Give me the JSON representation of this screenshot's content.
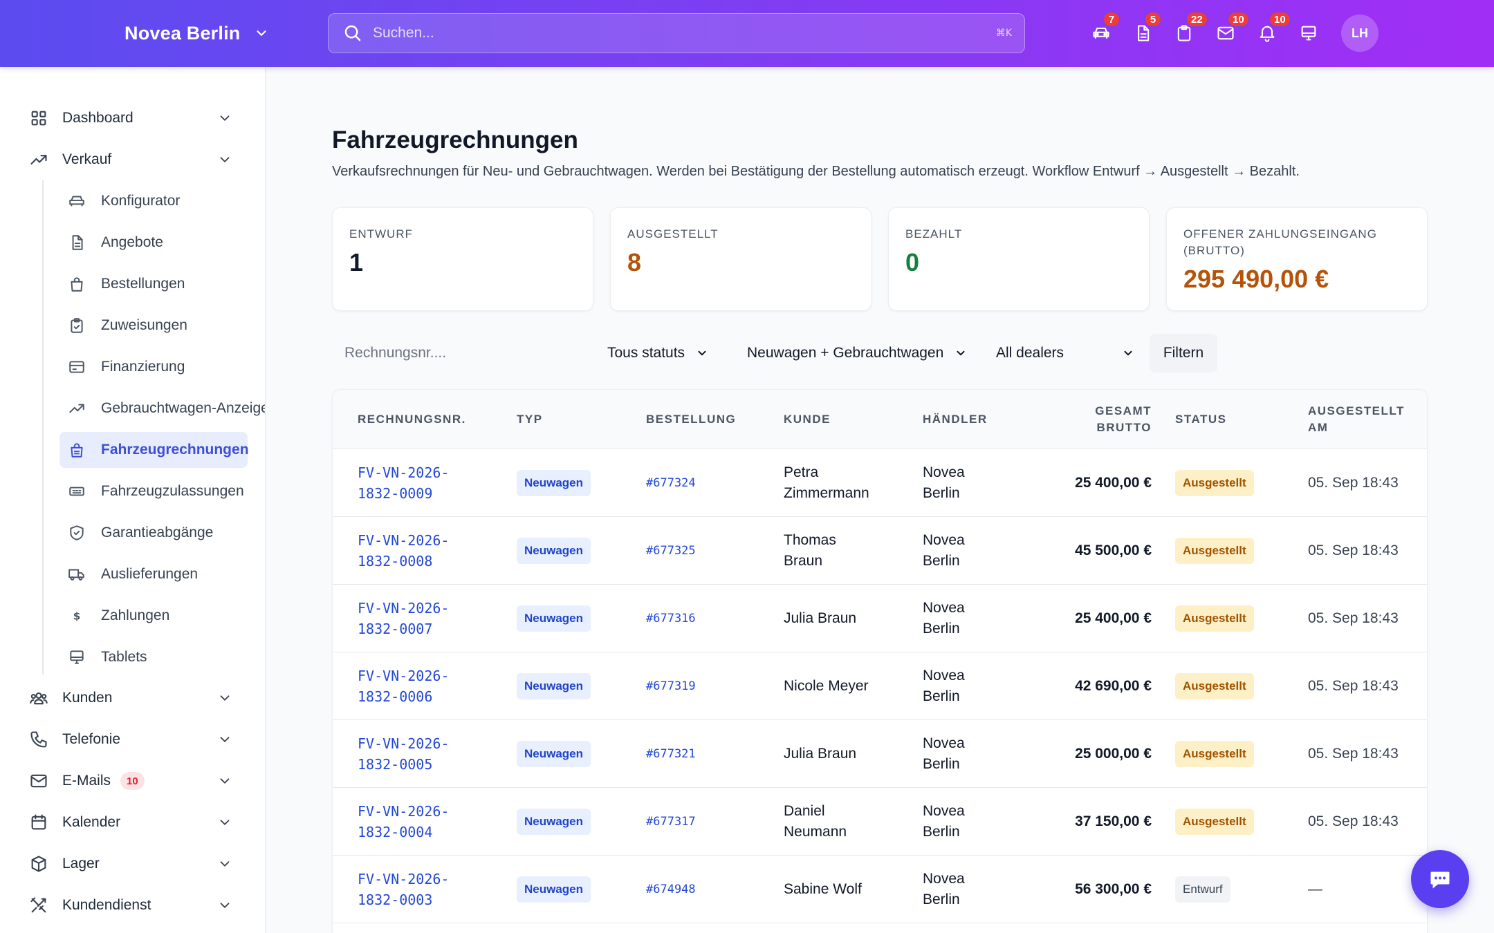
{
  "app": {
    "brand": "Novea Berlin",
    "search_placeholder": "Suchen...",
    "search_shortcut": "⌘K",
    "avatar_initials": "LH",
    "top_icons": [
      {
        "icon": "car-icon",
        "badge": "7"
      },
      {
        "icon": "document-icon",
        "badge": "5"
      },
      {
        "icon": "clipboard-icon",
        "badge": "22"
      },
      {
        "icon": "mail-icon",
        "badge": "10"
      },
      {
        "icon": "bell-icon",
        "badge": "10"
      },
      {
        "icon": "monitor-icon",
        "badge": ""
      }
    ],
    "colors": {
      "accent": "#3b4fd8",
      "amber": "#b45309",
      "green": "#15803d",
      "header_start": "#5b4cf0",
      "header_end": "#a12ef5"
    }
  },
  "sidebar": {
    "groups": {
      "dashboard": "Dashboard",
      "verkauf": "Verkauf",
      "kunden": "Kunden",
      "telefonie": "Telefonie",
      "emails": "E-Mails",
      "emails_badge": "10",
      "kalender": "Kalender",
      "lager": "Lager",
      "kundendienst": "Kundendienst"
    },
    "verkauf_items": [
      "Konfigurator",
      "Angebote",
      "Bestellungen",
      "Zuweisungen",
      "Finanzierung",
      "Gebrauchtwagen-Anzeigen",
      "Fahrzeugrechnungen",
      "Fahrzeugzulassungen",
      "Garantieabgänge",
      "Auslieferungen",
      "Zahlungen",
      "Tablets"
    ]
  },
  "page": {
    "title": "Fahrzeugrechnungen",
    "subtitle": "Verkaufsrechnungen für Neu- und Gebrauchtwagen. Werden bei Bestätigung der Bestellung automatisch erzeugt. Workflow Entwurf → Ausgestellt → Bezahlt."
  },
  "stats": [
    {
      "label": "Entwurf",
      "value": "1",
      "color": "#111827"
    },
    {
      "label": "Ausgestellt",
      "value": "8",
      "color": "#b45309"
    },
    {
      "label": "Bezahlt",
      "value": "0",
      "color": "#15803d"
    },
    {
      "label": "Offener Zahlungseingang (Brutto)",
      "value": "295 490,00 €",
      "color": "#b45309"
    }
  ],
  "filters": {
    "search_placeholder": "Rechnungsnr....",
    "status_selected": "Tous statuts",
    "type_selected": "Neuwagen + Gebrauchtwagen",
    "dealer_selected": "All dealers",
    "submit_label": "Filtern"
  },
  "table": {
    "columns": {
      "nr": "Rechnungsnr.",
      "typ": "Typ",
      "bestellung": "Bestellung",
      "kunde": "Kunde",
      "haendler": "Händler",
      "brutto": "Gesamt Brutto",
      "status": "Status",
      "ausgestellt": "Ausgestellt am"
    },
    "rows": [
      {
        "nr": "FV-VN-2026-1832-0009",
        "typ": "Neuwagen",
        "bestellung": "#677324",
        "kunde": "Petra Zimmermann",
        "haendler": "Novea Berlin",
        "brutto": "25 400,00 €",
        "status": "Ausgestellt",
        "datum": "05. Sep 18:43"
      },
      {
        "nr": "FV-VN-2026-1832-0008",
        "typ": "Neuwagen",
        "bestellung": "#677325",
        "kunde": "Thomas Braun",
        "haendler": "Novea Berlin",
        "brutto": "45 500,00 €",
        "status": "Ausgestellt",
        "datum": "05. Sep 18:43"
      },
      {
        "nr": "FV-VN-2026-1832-0007",
        "typ": "Neuwagen",
        "bestellung": "#677316",
        "kunde": "Julia Braun",
        "haendler": "Novea Berlin",
        "brutto": "25 400,00 €",
        "status": "Ausgestellt",
        "datum": "05. Sep 18:43"
      },
      {
        "nr": "FV-VN-2026-1832-0006",
        "typ": "Neuwagen",
        "bestellung": "#677319",
        "kunde": "Nicole Meyer",
        "haendler": "Novea Berlin",
        "brutto": "42 690,00 €",
        "status": "Ausgestellt",
        "datum": "05. Sep 18:43"
      },
      {
        "nr": "FV-VN-2026-1832-0005",
        "typ": "Neuwagen",
        "bestellung": "#677321",
        "kunde": "Julia Braun",
        "haendler": "Novea Berlin",
        "brutto": "25 000,00 €",
        "status": "Ausgestellt",
        "datum": "05. Sep 18:43"
      },
      {
        "nr": "FV-VN-2026-1832-0004",
        "typ": "Neuwagen",
        "bestellung": "#677317",
        "kunde": "Daniel Neumann",
        "haendler": "Novea Berlin",
        "brutto": "37 150,00 €",
        "status": "Ausgestellt",
        "datum": "05. Sep 18:43"
      },
      {
        "nr": "FV-VN-2026-1832-0003",
        "typ": "Neuwagen",
        "bestellung": "#674948",
        "kunde": "Sabine Wolf",
        "haendler": "Novea Berlin",
        "brutto": "56 300,00 €",
        "status": "Entwurf",
        "datum": "—"
      }
    ]
  }
}
